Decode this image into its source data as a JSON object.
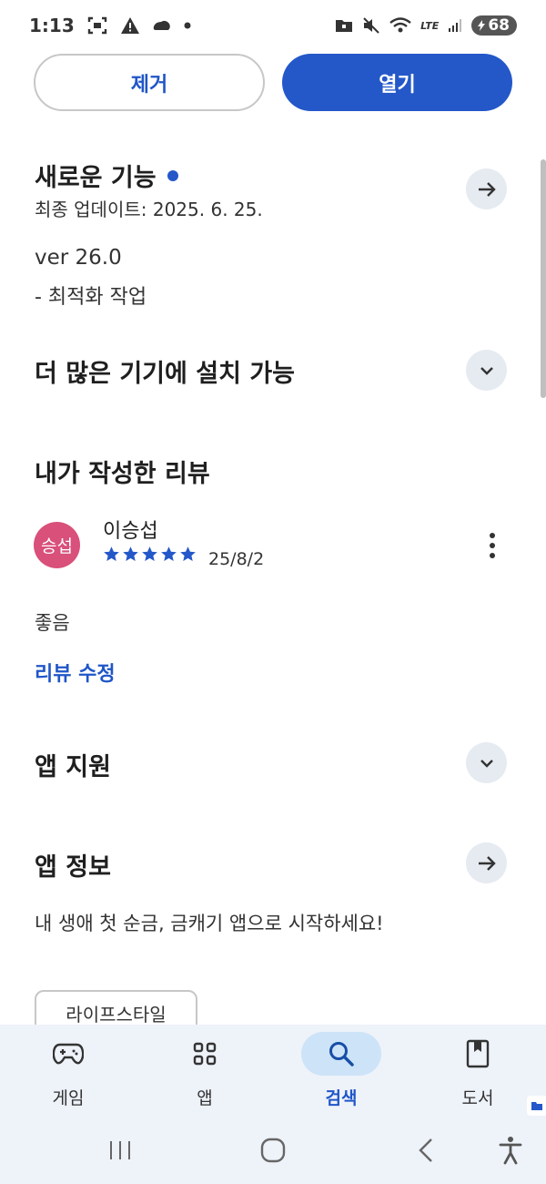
{
  "status_bar": {
    "time": "1:13",
    "network": "LTE",
    "battery": "68"
  },
  "actions": {
    "remove_label": "제거",
    "open_label": "열기"
  },
  "whats_new": {
    "title": "새로운 기능",
    "updated": "최종 업데이트: 2025. 6. 25.",
    "version": "ver 26.0",
    "note": "- 최적화 작업"
  },
  "more_devices": {
    "title": "더 많은 기기에 설치 가능"
  },
  "my_review": {
    "title": "내가 작성한 리뷰",
    "avatar_text": "승섭",
    "author": "이승섭",
    "stars": 5,
    "date": "25/8/2",
    "body": "좋음",
    "edit_label": "리뷰 수정"
  },
  "app_support": {
    "title": "앱 지원"
  },
  "app_info": {
    "title": "앱 정보",
    "description": "내 생애 첫 순금, 금캐기 앱으로 시작하세요!",
    "category_chip": "라이프스타일"
  },
  "bottom_nav": {
    "items": [
      {
        "label": "게임",
        "icon": "gamepad-icon"
      },
      {
        "label": "앱",
        "icon": "apps-grid-icon"
      },
      {
        "label": "검색",
        "icon": "search-icon",
        "active": true
      },
      {
        "label": "도서",
        "icon": "book-icon"
      }
    ]
  },
  "colors": {
    "accent": "#2458c9",
    "avatar": "#d9507a",
    "nav_bg": "#eef2f9",
    "nav_active": "#cde3f8"
  }
}
